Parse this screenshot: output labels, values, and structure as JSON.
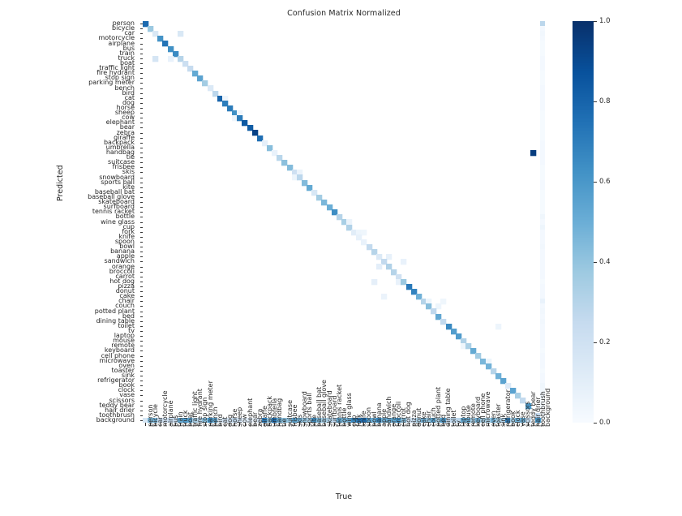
{
  "chart_data": {
    "type": "heatmap",
    "title": "Confusion Matrix Normalized",
    "xlabel": "True",
    "ylabel": "Predicted",
    "colormap": "Blues",
    "vmin": 0.0,
    "vmax": 1.0,
    "grid": false,
    "colorbar": {
      "position": "right",
      "ticks": [
        0.0,
        0.2,
        0.4,
        0.6,
        0.8,
        1.0
      ],
      "tick_labels": [
        "0.0",
        "0.2",
        "0.4",
        "0.6",
        "0.8",
        "1.0"
      ]
    },
    "categories": [
      "person",
      "bicycle",
      "car",
      "motorcycle",
      "airplane",
      "bus",
      "train",
      "truck",
      "boat",
      "traffic light",
      "fire hydrant",
      "stop sign",
      "parking meter",
      "bench",
      "bird",
      "cat",
      "dog",
      "horse",
      "sheep",
      "cow",
      "elephant",
      "bear",
      "zebra",
      "giraffe",
      "backpack",
      "umbrella",
      "handbag",
      "tie",
      "suitcase",
      "frisbee",
      "skis",
      "snowboard",
      "sports ball",
      "kite",
      "baseball bat",
      "baseball glove",
      "skateboard",
      "surfboard",
      "tennis racket",
      "bottle",
      "wine glass",
      "cup",
      "fork",
      "knife",
      "spoon",
      "bowl",
      "banana",
      "apple",
      "sandwich",
      "orange",
      "broccoli",
      "carrot",
      "hot dog",
      "pizza",
      "donut",
      "cake",
      "chair",
      "couch",
      "potted plant",
      "bed",
      "dining table",
      "toilet",
      "tv",
      "laptop",
      "mouse",
      "remote",
      "keyboard",
      "cell phone",
      "microwave",
      "oven",
      "toaster",
      "sink",
      "refrigerator",
      "book",
      "clock",
      "vase",
      "scissors",
      "teddy bear",
      "hair drier",
      "toothbrush",
      "background"
    ],
    "x_categories": [
      "person",
      "bicycle",
      "car",
      "motorcycle",
      "airplane",
      "bus",
      "train",
      "truck",
      "boat",
      "traffic light",
      "fire hydrant",
      "stop sign",
      "parking meter",
      "bench",
      "bird",
      "cat",
      "dog",
      "horse",
      "sheep",
      "cow",
      "elephant",
      "bear",
      "zebra",
      "giraffe",
      "backpack",
      "umbrella",
      "handbag",
      "tie",
      "suitcase",
      "frisbee",
      "skis",
      "snowboard",
      "sports ball",
      "kite",
      "baseball bat",
      "baseball glove",
      "skateboard",
      "surfboard",
      "tennis racket",
      "bottle",
      "wine glass",
      "cup",
      "fork",
      "knife",
      "spoon",
      "bowl",
      "banana",
      "apple",
      "sandwich",
      "orange",
      "broccoli",
      "carrot",
      "hot dog",
      "pizza",
      "donut",
      "cake",
      "chair",
      "couch",
      "potted plant",
      "bed",
      "dining table",
      "toilet",
      "tv",
      "laptop",
      "mouse",
      "remote",
      "keyboard",
      "cell phone",
      "microwave",
      "oven",
      "toaster",
      "sink",
      "refrigerator",
      "book",
      "clock",
      "vase",
      "scissors",
      "teddy bear",
      "hair drier",
      "toothbrush",
      "background"
    ],
    "diagonal_values": [
      0.78,
      0.38,
      0.15,
      0.62,
      0.74,
      0.63,
      0.65,
      0.3,
      0.22,
      0.25,
      0.52,
      0.55,
      0.36,
      0.14,
      0.28,
      0.8,
      0.7,
      0.71,
      0.63,
      0.71,
      0.84,
      0.83,
      0.93,
      0.76,
      0.09,
      0.43,
      0.07,
      0.29,
      0.42,
      0.44,
      0.21,
      0.28,
      0.44,
      0.52,
      0.16,
      0.36,
      0.46,
      0.5,
      0.64,
      0.3,
      0.34,
      0.32,
      0.11,
      0.08,
      0.07,
      0.26,
      0.3,
      0.14,
      0.26,
      0.32,
      0.3,
      0.2,
      0.38,
      0.72,
      0.68,
      0.49,
      0.3,
      0.43,
      0.27,
      0.53,
      0.26,
      0.66,
      0.57,
      0.58,
      0.32,
      0.33,
      0.52,
      0.36,
      0.46,
      0.48,
      0.3,
      0.49,
      0.55,
      0.13,
      0.55,
      0.34,
      0.26,
      0.6,
      0.0,
      0.24,
      0.0
    ],
    "background_row_values": [
      0.16,
      0.45,
      0.47,
      0.25,
      0.2,
      0.25,
      0.22,
      0.5,
      0.58,
      0.55,
      0.34,
      0.3,
      0.42,
      0.62,
      0.52,
      0.14,
      0.19,
      0.18,
      0.26,
      0.2,
      0.11,
      0.13,
      0.05,
      0.17,
      0.7,
      0.42,
      0.74,
      0.5,
      0.42,
      0.4,
      0.54,
      0.48,
      0.4,
      0.34,
      0.62,
      0.45,
      0.36,
      0.33,
      0.27,
      0.52,
      0.46,
      0.48,
      0.66,
      0.72,
      0.76,
      0.55,
      0.49,
      0.66,
      0.48,
      0.5,
      0.52,
      0.62,
      0.42,
      0.19,
      0.23,
      0.33,
      0.48,
      0.4,
      0.56,
      0.34,
      0.58,
      0.25,
      0.28,
      0.28,
      0.52,
      0.5,
      0.34,
      0.48,
      0.36,
      0.34,
      0.48,
      0.36,
      0.32,
      0.7,
      0.35,
      0.48,
      0.5,
      0.26,
      0.0,
      0.6,
      0.0
    ],
    "background_column_values": [
      0.28,
      0.02,
      0.03,
      0.02,
      0.01,
      0.01,
      0.01,
      0.02,
      0.02,
      0.02,
      0.01,
      0.01,
      0.01,
      0.02,
      0.02,
      0.02,
      0.02,
      0.02,
      0.01,
      0.01,
      0.01,
      0.01,
      0.01,
      0.01,
      0.02,
      0.02,
      0.02,
      0.02,
      0.02,
      0.01,
      0.01,
      0.01,
      0.02,
      0.02,
      0.01,
      0.01,
      0.01,
      0.01,
      0.01,
      0.04,
      0.02,
      0.05,
      0.02,
      0.02,
      0.02,
      0.03,
      0.02,
      0.02,
      0.02,
      0.02,
      0.02,
      0.02,
      0.01,
      0.02,
      0.02,
      0.02,
      0.07,
      0.02,
      0.03,
      0.02,
      0.03,
      0.02,
      0.02,
      0.02,
      0.02,
      0.02,
      0.01,
      0.02,
      0.02,
      0.02,
      0.01,
      0.02,
      0.02,
      0.04,
      0.03,
      0.03,
      0.01,
      0.02,
      0.0,
      0.01,
      0.0
    ],
    "off_diagonal_cells": [
      {
        "true": "car",
        "predicted": "truck",
        "value": 0.17
      },
      {
        "true": "truck",
        "predicted": "car",
        "value": 0.15
      },
      {
        "true": "bus",
        "predicted": "truck",
        "value": 0.07
      },
      {
        "true": "hair drier",
        "predicted": "handbag",
        "value": 0.95
      },
      {
        "true": "banana",
        "predicted": "hot dog",
        "value": 0.09
      },
      {
        "true": "apple",
        "predicted": "orange",
        "value": 0.1
      },
      {
        "true": "orange",
        "predicted": "apple",
        "value": 0.08
      },
      {
        "true": "carrot",
        "predicted": "hot dog",
        "value": 0.07
      },
      {
        "true": "sandwich",
        "predicted": "cake",
        "value": 0.06
      },
      {
        "true": "hot dog",
        "predicted": "sandwich",
        "value": 0.07
      },
      {
        "true": "cup",
        "predicted": "wine glass",
        "value": 0.06
      },
      {
        "true": "oven",
        "predicted": "microwave",
        "value": 0.05
      },
      {
        "true": "sink",
        "predicted": "toilet",
        "value": 0.05
      },
      {
        "true": "mouse",
        "predicted": "remote",
        "value": 0.04
      },
      {
        "true": "couch",
        "predicted": "chair",
        "value": 0.05
      },
      {
        "true": "bed",
        "predicted": "couch",
        "value": 0.05
      },
      {
        "true": "dining table",
        "predicted": "chair",
        "value": 0.04
      },
      {
        "true": "knife",
        "predicted": "fork",
        "value": 0.05
      },
      {
        "true": "spoon",
        "predicted": "fork",
        "value": 0.04
      },
      {
        "true": "cow",
        "predicted": "sheep",
        "value": 0.04
      },
      {
        "true": "sheep",
        "predicted": "cow",
        "value": 0.04
      },
      {
        "true": "dog",
        "predicted": "cat",
        "value": 0.04
      },
      {
        "true": "snowboard",
        "predicted": "skis",
        "value": 0.06
      },
      {
        "true": "skis",
        "predicted": "snowboard",
        "value": 0.05
      }
    ]
  }
}
